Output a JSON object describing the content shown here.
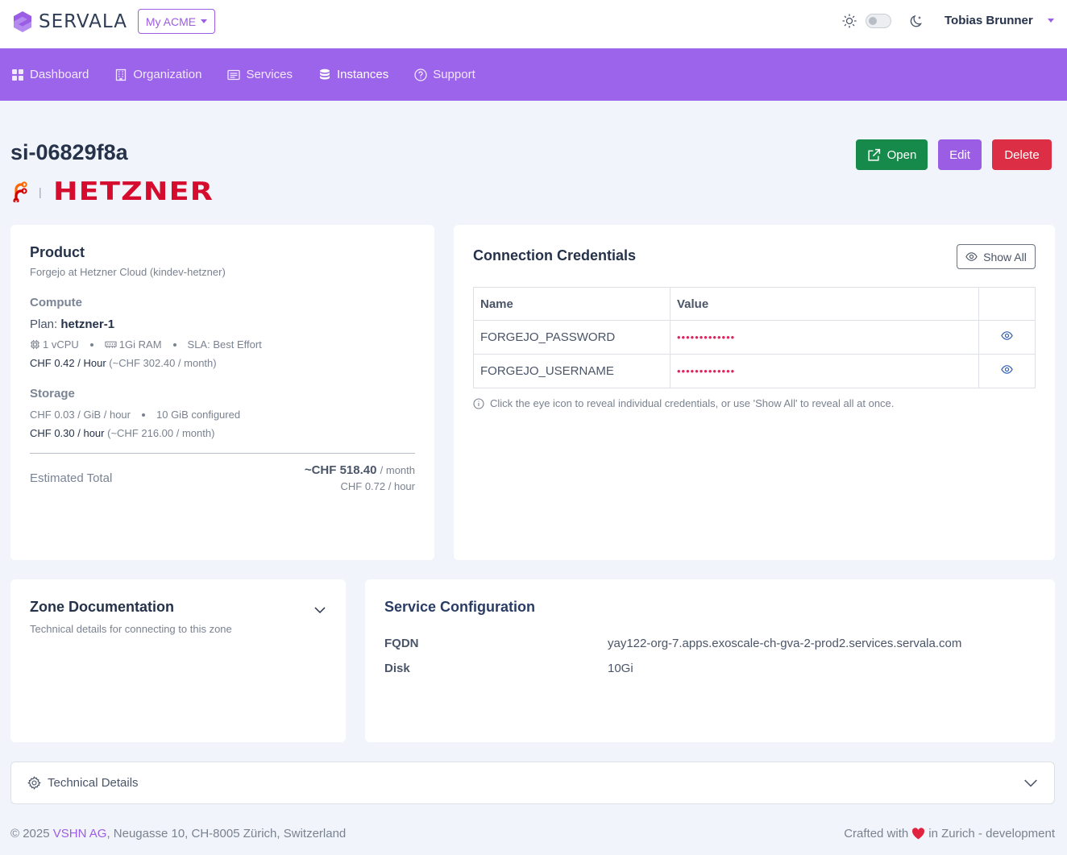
{
  "app": {
    "name": "SERVALA"
  },
  "header": {
    "org_selector": "My ACME",
    "user_name": "Tobias Brunner"
  },
  "nav": {
    "items": [
      {
        "label": "Dashboard",
        "icon": "grid-icon"
      },
      {
        "label": "Organization",
        "icon": "building-icon"
      },
      {
        "label": "Services",
        "icon": "list-icon"
      },
      {
        "label": "Instances",
        "icon": "database-icon",
        "active": true
      },
      {
        "label": "Support",
        "icon": "help-circle-icon"
      }
    ]
  },
  "instance": {
    "title": "si-06829f8a",
    "provider_separator": "|",
    "provider_logo_text": "HETZNER",
    "actions": {
      "open": "Open",
      "edit": "Edit",
      "delete": "Delete"
    }
  },
  "product": {
    "title": "Product",
    "subtitle": "Forgejo at Hetzner Cloud (kindev-hetzner)",
    "compute": {
      "heading": "Compute",
      "plan_label": "Plan:",
      "plan_value": "hetzner-1",
      "vcpu": "1 vCPU",
      "ram": "1Gi RAM",
      "sla": "SLA: Best Effort",
      "price_hour": "CHF 0.42 / Hour",
      "price_month": "(~CHF 302.40 / month)"
    },
    "storage": {
      "heading": "Storage",
      "rate": "CHF 0.03 / GiB / hour",
      "configured": "10 GiB configured",
      "price_hour": "CHF 0.30 / hour",
      "price_month": "(~CHF 216.00 / month)"
    },
    "total": {
      "label": "Estimated Total",
      "month_value": "~CHF 518.40",
      "month_unit": "/ month",
      "hour": "CHF 0.72 / hour"
    }
  },
  "credentials": {
    "title": "Connection Credentials",
    "show_all": "Show All",
    "columns": [
      "Name",
      "Value",
      ""
    ],
    "rows": [
      {
        "name": "FORGEJO_PASSWORD",
        "value": "•••••••••••••"
      },
      {
        "name": "FORGEJO_USERNAME",
        "value": "•••••••••••••"
      }
    ],
    "hint": "Click the eye icon to reveal individual credentials, or use 'Show All' to reveal all at once."
  },
  "zone": {
    "title": "Zone Documentation",
    "subtitle": "Technical details for connecting to this zone"
  },
  "service_config": {
    "title": "Service Configuration",
    "fqdn_label": "FQDN",
    "fqdn_value": "yay122-org-7.apps.exoscale-ch-gva-2-prod2.services.servala.com",
    "disk_label": "Disk",
    "disk_value": "10Gi"
  },
  "technical": {
    "title": "Technical Details"
  },
  "footer": {
    "copyright": "© 2025",
    "company": "VSHN AG",
    "address": ", Neugasse 10, CH-8005 Zürich, Switzerland",
    "crafted_prefix": "Crafted with",
    "crafted_suffix": "in Zurich - development"
  },
  "colors": {
    "accent": "#9c64ea",
    "success": "#168a4a",
    "danger": "#dc2f45",
    "hetzner": "#d50c2d"
  }
}
